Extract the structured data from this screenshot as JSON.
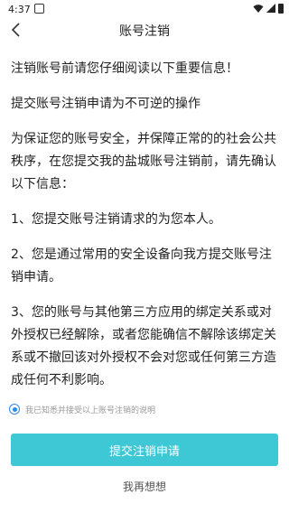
{
  "status_bar": {
    "time": "4:37",
    "icons": [
      "notification-icon",
      "wifi-icon",
      "signal-icon",
      "battery-icon"
    ]
  },
  "header": {
    "title": "账号注销",
    "back_icon": "chevron-left-icon"
  },
  "content": {
    "paragraphs": [
      "注销账号前请您仔细阅读以下重要信息！",
      "提交账号注销申请为不可逆的操作",
      "为保证您的账号安全，并保障正常的的社会公共秩序，在您提交我的盐城账号注销前，请先确认以下信息：",
      "1、您提交账号注销请求的为您本人。",
      "2、您是通过常用的安全设备向我方提交账号注销申请。",
      "3、您的账号与其他第三方应用的绑定关系或对外授权已经解除，或者您能确信不解除该绑定关系或不撤回该对外授权不会对您或任何第三方造成任何不利影响。"
    ]
  },
  "agreement": {
    "label": "我已知悉并接受以上账号注销的说明",
    "checked": true
  },
  "actions": {
    "submit_label": "提交注销申请",
    "cancel_label": "我再想想"
  },
  "colors": {
    "accent": "#3ec8d5",
    "radio": "#2f8be8",
    "text": "#222222",
    "muted": "#999999"
  }
}
